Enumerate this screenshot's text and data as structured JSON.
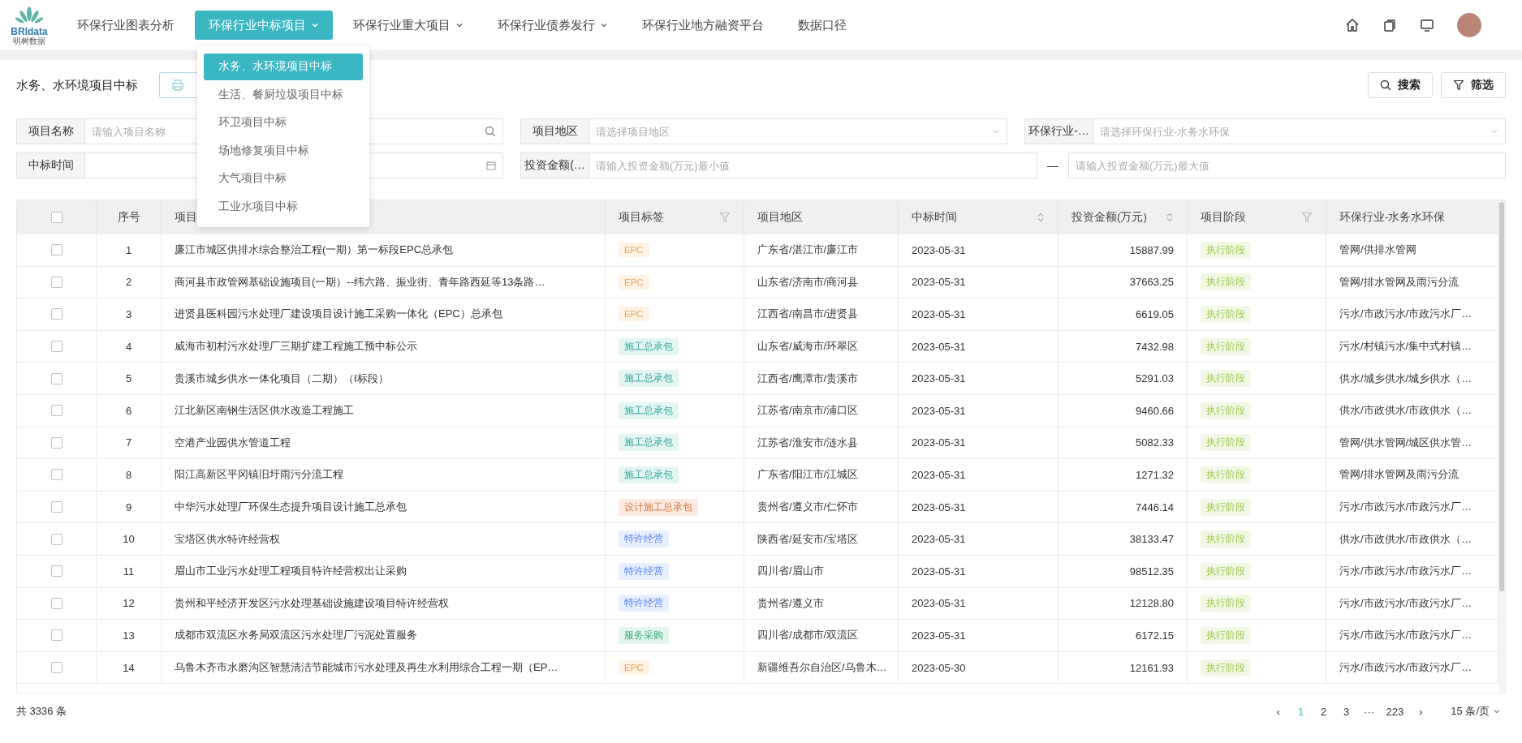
{
  "nav": {
    "logo": {
      "brand": "BRIdata",
      "sub": "明树数据"
    },
    "items": [
      {
        "label": "环保行业图表分析",
        "selected": false,
        "has_menu": false
      },
      {
        "label": "环保行业中标项目",
        "selected": true,
        "has_menu": true
      },
      {
        "label": "环保行业重大项目",
        "selected": false,
        "has_menu": true
      },
      {
        "label": "环保行业债券发行",
        "selected": false,
        "has_menu": true
      },
      {
        "label": "环保行业地方融资平台",
        "selected": false,
        "has_menu": false
      },
      {
        "label": "数据口径",
        "selected": false,
        "has_menu": false
      }
    ]
  },
  "dropdown": [
    {
      "label": "水务、水环境项目中标",
      "selected": true
    },
    {
      "label": "生活、餐厨垃圾项目中标",
      "selected": false
    },
    {
      "label": "环卫项目中标",
      "selected": false
    },
    {
      "label": "场地修复项目中标",
      "selected": false
    },
    {
      "label": "大气项目中标",
      "selected": false
    },
    {
      "label": "工业水项目中标",
      "selected": false
    }
  ],
  "page_title": "水务、水环境项目中标",
  "actions": [
    {
      "label": "搜索"
    },
    {
      "label": "筛选"
    }
  ],
  "filters": {
    "row1": [
      {
        "label": "项目名称",
        "placeholder": "请输入项目名称",
        "kind": "search"
      },
      {
        "label": "项目地区",
        "placeholder": "请选择项目地区",
        "kind": "select"
      },
      {
        "label": "环保行业-…",
        "placeholder": "请选择环保行业-水务水环保",
        "kind": "select"
      }
    ],
    "date": {
      "label": "中标时间"
    },
    "amount": {
      "label": "投资金额(…",
      "min_placeholder": "请输入投资金额(万元)最小值",
      "separator": "—",
      "max_placeholder": "请输入投资金额(万元)最大值"
    }
  },
  "table": {
    "select_all": {
      "checked": false
    },
    "columns": [
      {
        "label": "序号",
        "kind": "plain"
      },
      {
        "label": "项目",
        "kind": "plain"
      },
      {
        "label": "项目标签",
        "kind": "filter"
      },
      {
        "label": "项目地区",
        "kind": "plain"
      },
      {
        "label": "中标时间",
        "kind": "sort"
      },
      {
        "label": "投资金额(万元)",
        "kind": "sort"
      },
      {
        "label": "项目阶段",
        "kind": "filter"
      },
      {
        "label": "环保行业-水务水环保",
        "kind": "plain"
      }
    ],
    "rows": [
      {
        "checked": false,
        "no": "1",
        "name": "廉江市城区供排水综合整治工程(一期）第一标段EPC总承包",
        "tag": {
          "text": "EPC",
          "kind": "epc"
        },
        "region": "广东省/湛江市/廉江市",
        "date": "2023-05-31",
        "amount": "15887.99",
        "stage": "执行阶段",
        "industry": "管网/供排水管网"
      },
      {
        "checked": false,
        "no": "2",
        "name": "商河县市政管网基础设施项目(一期）--纬六路、振业街、青年路西延等13条路…",
        "tag": {
          "text": "EPC",
          "kind": "epc"
        },
        "region": "山东省/济南市/商河县",
        "date": "2023-05-31",
        "amount": "37663.25",
        "stage": "执行阶段",
        "industry": "管网/排水管网及雨污分流"
      },
      {
        "checked": false,
        "no": "3",
        "name": "进贤县医科园污水处理厂建设项目设计施工采购一体化（EPC）总承包",
        "tag": {
          "text": "EPC",
          "kind": "epc"
        },
        "region": "江西省/南昌市/进贤县",
        "date": "2023-05-31",
        "amount": "6619.05",
        "stage": "执行阶段",
        "industry": "污水/市政污水/市政污水厂…"
      },
      {
        "checked": false,
        "no": "4",
        "name": "威海市初村污水处理厂三期扩建工程施工预中标公示",
        "tag": {
          "text": "施工总承包",
          "kind": "construction"
        },
        "region": "山东省/威海市/环翠区",
        "date": "2023-05-31",
        "amount": "7432.98",
        "stage": "执行阶段",
        "industry": "污水/村镇污水/集中式村镇…"
      },
      {
        "checked": false,
        "no": "5",
        "name": "贵溪市城乡供水一体化项目（二期）（Ⅰ标段）",
        "tag": {
          "text": "施工总承包",
          "kind": "construction"
        },
        "region": "江西省/鹰潭市/贵溪市",
        "date": "2023-05-31",
        "amount": "5291.03",
        "stage": "执行阶段",
        "industry": "供水/城乡供水/城乡供水（…"
      },
      {
        "checked": false,
        "no": "6",
        "name": "江北新区南钢生活区供水改造工程施工",
        "tag": {
          "text": "施工总承包",
          "kind": "construction"
        },
        "region": "江苏省/南京市/浦口区",
        "date": "2023-05-31",
        "amount": "9460.66",
        "stage": "执行阶段",
        "industry": "供水/市政供水/市政供水（…"
      },
      {
        "checked": false,
        "no": "7",
        "name": "空港产业园供水管道工程",
        "tag": {
          "text": "施工总承包",
          "kind": "construction"
        },
        "region": "江苏省/淮安市/涟水县",
        "date": "2023-05-31",
        "amount": "5082.33",
        "stage": "执行阶段",
        "industry": "管网/供水管网/城区供水管…"
      },
      {
        "checked": false,
        "no": "8",
        "name": "阳江高新区平冈镇旧圩雨污分流工程",
        "tag": {
          "text": "施工总承包",
          "kind": "construction"
        },
        "region": "广东省/阳江市/江城区",
        "date": "2023-05-31",
        "amount": "1271.32",
        "stage": "执行阶段",
        "industry": "管网/排水管网及雨污分流"
      },
      {
        "checked": false,
        "no": "9",
        "name": "中华污水处理厂环保生态提升项目设计施工总承包",
        "tag": {
          "text": "设计施工总承包",
          "kind": "design"
        },
        "region": "贵州省/遵义市/仁怀市",
        "date": "2023-05-31",
        "amount": "7446.14",
        "stage": "执行阶段",
        "industry": "污水/市政污水/市政污水厂…"
      },
      {
        "checked": false,
        "no": "10",
        "name": "宝塔区供水特许经营权",
        "tag": {
          "text": "特许经营",
          "kind": "franchise"
        },
        "region": "陕西省/延安市/宝塔区",
        "date": "2023-05-31",
        "amount": "38133.47",
        "stage": "执行阶段",
        "industry": "供水/市政供水/市政供水（…"
      },
      {
        "checked": false,
        "no": "11",
        "name": "眉山市工业污水处理工程项目特许经营权出让采购",
        "tag": {
          "text": "特许经营",
          "kind": "franchise"
        },
        "region": "四川省/眉山市",
        "date": "2023-05-31",
        "amount": "98512.35",
        "stage": "执行阶段",
        "industry": "污水/市政污水/市政污水厂…"
      },
      {
        "checked": false,
        "no": "12",
        "name": "贵州和平经济开发区污水处理基础设施建设项目特许经营权",
        "tag": {
          "text": "特许经营",
          "kind": "franchise"
        },
        "region": "贵州省/遵义市",
        "date": "2023-05-31",
        "amount": "12128.80",
        "stage": "执行阶段",
        "industry": "污水/市政污水/市政污水厂…"
      },
      {
        "checked": false,
        "no": "13",
        "name": "成都市双流区水务局双流区污水处理厂污泥处置服务",
        "tag": {
          "text": "服务采购",
          "kind": "service"
        },
        "region": "四川省/成都市/双流区",
        "date": "2023-05-31",
        "amount": "6172.15",
        "stage": "执行阶段",
        "industry": "污水/市政污水/市政污水厂…"
      },
      {
        "checked": false,
        "no": "14",
        "name": "乌鲁木齐市水磨沟区智慧清洁节能城市污水处理及再生水利用综合工程一期（EP…",
        "tag": {
          "text": "EPC",
          "kind": "epc"
        },
        "region": "新疆维吾尔自治区/乌鲁木…",
        "date": "2023-05-30",
        "amount": "12161.93",
        "stage": "执行阶段",
        "industry": "污水/市政污水/市政污水厂…"
      }
    ]
  },
  "footer": {
    "total": "共 3336 条",
    "pages": [
      {
        "label": "1",
        "selected": true
      },
      {
        "label": "2",
        "selected": false
      },
      {
        "label": "3",
        "selected": false
      },
      {
        "label": "···",
        "selected": false
      },
      {
        "label": "223",
        "selected": false
      }
    ],
    "prev": "‹",
    "next": "›",
    "page_size": "15 条/页"
  }
}
